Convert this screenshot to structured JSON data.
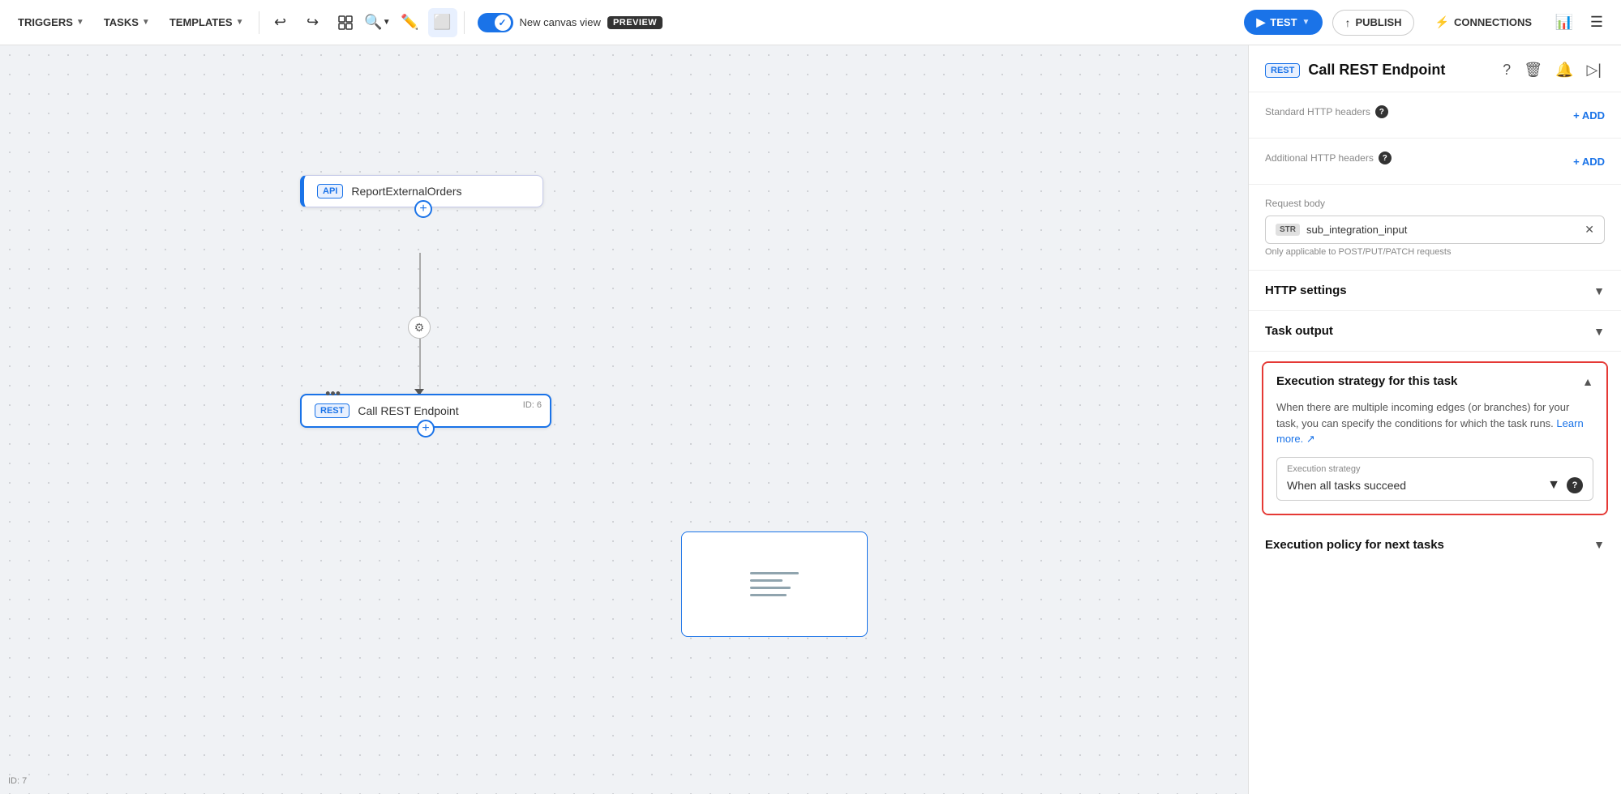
{
  "toolbar": {
    "triggers_label": "TRIGGERS",
    "tasks_label": "TASKS",
    "templates_label": "TEMPLATES",
    "canvas_label": "New canvas view",
    "preview_badge": "PREVIEW",
    "test_label": "TEST",
    "publish_label": "PUBLISH",
    "connections_label": "CONNECTIONS"
  },
  "canvas": {
    "api_node": {
      "badge": "API",
      "label": "ReportExternalOrders"
    },
    "rest_node": {
      "badge": "REST",
      "label": "Call REST Endpoint",
      "id": "ID: 6"
    },
    "id_label": "ID: 7"
  },
  "panel": {
    "rest_badge": "REST",
    "title": "Call REST Endpoint",
    "std_http_label": "Standard HTTP headers",
    "add_label": "+ ADD",
    "add_label2": "+ ADD",
    "additional_http_label": "Additional HTTP headers",
    "request_body_label": "Request body",
    "str_badge": "STR",
    "request_body_value": "sub_integration_input",
    "request_body_note": "Only applicable to POST/PUT/PATCH requests",
    "http_settings_label": "HTTP settings",
    "task_output_label": "Task output",
    "exec_strategy_section_title": "Execution strategy for this task",
    "exec_desc": "When there are multiple incoming edges (or branches) for your task, you can specify the conditions for which the task runs.",
    "learn_more": "Learn more.",
    "exec_strategy_label": "Execution strategy",
    "exec_strategy_value": "When all tasks succeed",
    "exec_policy_label": "Execution policy for next tasks"
  }
}
